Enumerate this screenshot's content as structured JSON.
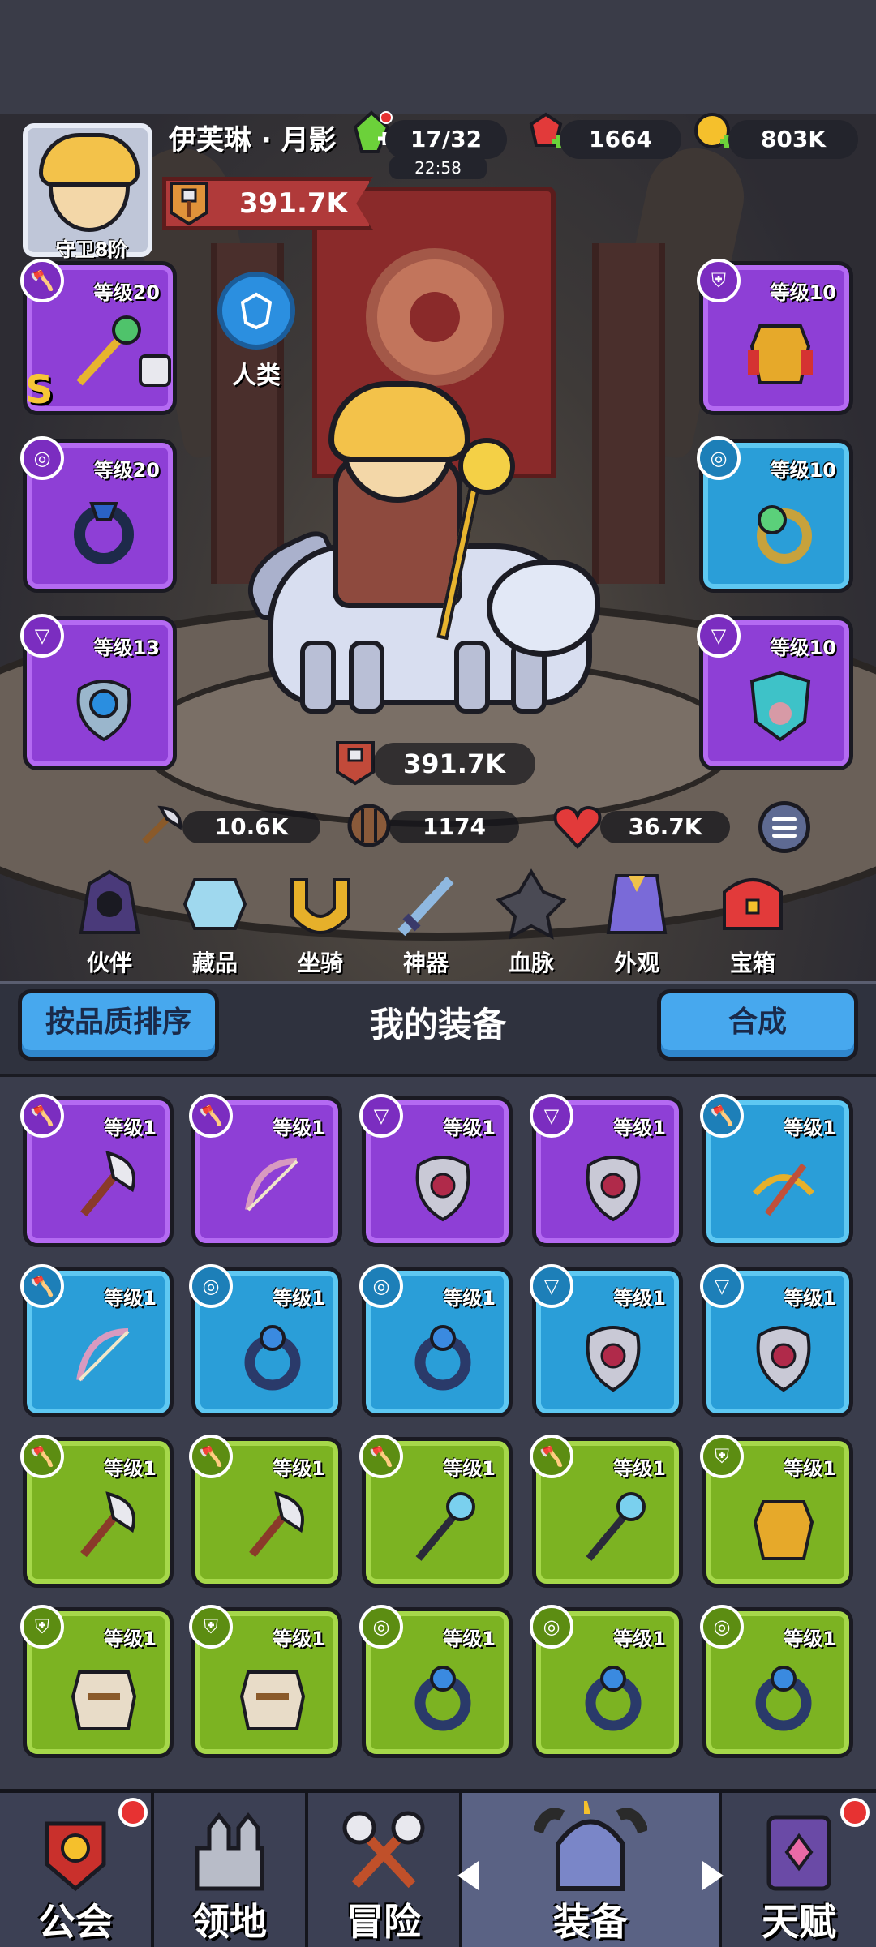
{
  "player": {
    "name": "伊芙琳 · 月影",
    "rank": "守卫8阶",
    "combat_power": "391.7K"
  },
  "resources": {
    "energy": "17/32",
    "energy_timer": "22:58",
    "gems": "1664",
    "gold": "803K"
  },
  "race": {
    "label": "人类"
  },
  "equipped": {
    "weapon": {
      "level": "等级20",
      "badge": "S",
      "icon": "staff-icon",
      "locked": true
    },
    "ring": {
      "level": "等级20",
      "icon": "ring-icon"
    },
    "necklace": {
      "level": "等级13",
      "icon": "amulet-icon"
    },
    "armor": {
      "level": "等级10",
      "icon": "armor-icon"
    },
    "ring2": {
      "level": "等级10",
      "icon": "ring-icon"
    },
    "helmet": {
      "level": "等级10",
      "icon": "mask-icon"
    }
  },
  "hero": {
    "power": "391.7K",
    "attack": "10.6K",
    "defense": "1174",
    "hp": "36.7K"
  },
  "categories": [
    {
      "label": "伙伴",
      "icon": "companion-icon"
    },
    {
      "label": "藏品",
      "icon": "collection-icon"
    },
    {
      "label": "坐骑",
      "icon": "mount-icon"
    },
    {
      "label": "神器",
      "icon": "artifact-icon"
    },
    {
      "label": "血脉",
      "icon": "bloodline-icon"
    },
    {
      "label": "外观",
      "icon": "appearance-icon"
    },
    {
      "label": "宝箱",
      "icon": "chest-icon"
    }
  ],
  "inventory": {
    "sort_label": "按品质排序",
    "title": "我的装备",
    "merge_label": "合成",
    "items": [
      {
        "rarity": "purple",
        "level": "等级1",
        "icon": "axe-icon",
        "type": "weapon"
      },
      {
        "rarity": "purple",
        "level": "等级1",
        "icon": "bow-icon",
        "type": "weapon"
      },
      {
        "rarity": "purple",
        "level": "等级1",
        "icon": "amulet-icon",
        "type": "necklace"
      },
      {
        "rarity": "purple",
        "level": "等级1",
        "icon": "amulet-icon",
        "type": "necklace"
      },
      {
        "rarity": "blue",
        "level": "等级1",
        "icon": "crossbow-icon",
        "type": "weapon"
      },
      {
        "rarity": "blue",
        "level": "等级1",
        "icon": "bow-icon",
        "type": "weapon"
      },
      {
        "rarity": "blue",
        "level": "等级1",
        "icon": "ring-icon",
        "type": "ring"
      },
      {
        "rarity": "blue",
        "level": "等级1",
        "icon": "ring-icon",
        "type": "ring"
      },
      {
        "rarity": "blue",
        "level": "等级1",
        "icon": "amulet-icon",
        "type": "necklace"
      },
      {
        "rarity": "blue",
        "level": "等级1",
        "icon": "amulet-icon",
        "type": "necklace"
      },
      {
        "rarity": "green",
        "level": "等级1",
        "icon": "axe-icon",
        "type": "weapon"
      },
      {
        "rarity": "green",
        "level": "等级1",
        "icon": "axe-icon",
        "type": "weapon"
      },
      {
        "rarity": "green",
        "level": "等级1",
        "icon": "staff-icon",
        "type": "weapon"
      },
      {
        "rarity": "green",
        "level": "等级1",
        "icon": "staff-icon",
        "type": "weapon"
      },
      {
        "rarity": "green",
        "level": "等级1",
        "icon": "armor-icon",
        "type": "armor"
      },
      {
        "rarity": "green",
        "level": "等级1",
        "icon": "vest-icon",
        "type": "armor"
      },
      {
        "rarity": "green",
        "level": "等级1",
        "icon": "vest-icon",
        "type": "armor"
      },
      {
        "rarity": "green",
        "level": "等级1",
        "icon": "ring-icon",
        "type": "ring"
      },
      {
        "rarity": "green",
        "level": "等级1",
        "icon": "ring-icon",
        "type": "ring"
      },
      {
        "rarity": "green",
        "level": "等级1",
        "icon": "ring-icon",
        "type": "ring"
      }
    ]
  },
  "nav": [
    {
      "label": "公会",
      "icon": "guild-icon",
      "badge": true
    },
    {
      "label": "领地",
      "icon": "castle-icon",
      "badge": false
    },
    {
      "label": "冒险",
      "icon": "crossed-axes-icon",
      "badge": false
    },
    {
      "label": "装备",
      "icon": "helmet-icon",
      "badge": false,
      "active": true
    },
    {
      "label": "天赋",
      "icon": "talent-book-icon",
      "badge": true
    }
  ],
  "colors": {
    "purple": "#8e3fd6",
    "blue": "#2a9ed8",
    "green": "#7cb322",
    "accent_red": "#b03a3a",
    "button_blue": "#47a8ee"
  }
}
